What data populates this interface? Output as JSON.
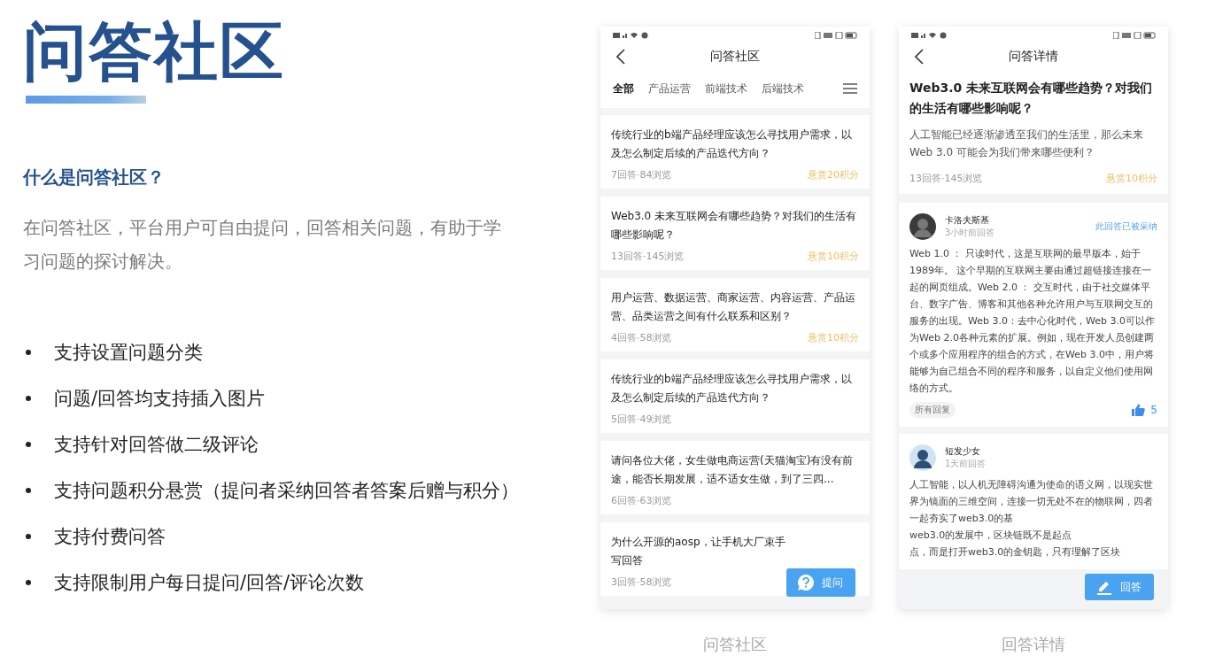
{
  "slide": {
    "title": "问答社区",
    "subtitle": "什么是问答社区？",
    "description": "在问答社区，平台用户可自由提问，回答相关问题，有助于学习问题的探讨解决。",
    "features": [
      "支持设置问题分类",
      "问题/回答均支持插入图片",
      "支持针对回答做二级评论",
      "支持问题积分悬赏（提问者采纳回答者答案后赠与积分）",
      "支持付费问答",
      "支持限制用户每日提问/回答/评论次数"
    ]
  },
  "list_screen": {
    "title": "问答社区",
    "caption": "问答社区",
    "tabs": [
      {
        "label": "全部",
        "selected": true
      },
      {
        "label": "产品运营",
        "selected": false
      },
      {
        "label": "前端技术",
        "selected": false
      },
      {
        "label": "后端技术",
        "selected": false
      }
    ],
    "questions": [
      {
        "lines": [
          "传统行业的b端产品经理应该怎么寻找用户需求，以及怎么制定后续的产品迭代方向？"
        ],
        "meta": "7回答·84浏览",
        "reward": "悬赏20积分"
      },
      {
        "lines": [
          "Web3.0 未来互联网会有哪些趋势？对我们的生活有哪些影响呢？"
        ],
        "meta": "13回答·145浏览",
        "reward": "悬赏10积分"
      },
      {
        "lines": [
          "用户运营、数据运营、商家运营、内容运营、产品运营、品类运营之间有什么联系和区别？"
        ],
        "meta": "4回答·58浏览",
        "reward": "悬赏10积分"
      },
      {
        "lines": [
          "传统行业的b端产品经理应该怎么寻找用户需求，以及怎么制定后续的产品迭代方向？"
        ],
        "meta": "5回答·49浏览"
      },
      {
        "lines": [
          "请问各位大佬，女生做电商运营(天猫淘宝)有没有前途，能否长期发展，适不适女生做，到了三四..."
        ],
        "meta": "6回答·63浏览"
      },
      {
        "lines": [
          "为什么开源的aosp，让手机大厂束手",
          "写回答"
        ],
        "meta": "3回答·58浏览"
      }
    ],
    "fab": "提问"
  },
  "detail_screen": {
    "title": "问答详情",
    "caption": "回答详情",
    "question": {
      "title": "Web3.0 未来互联网会有哪些趋势？对我们的生活有哪些影响呢？",
      "body": "人工智能已经逐渐渗透至我们的生活里，那么未来 Web 3.0 可能会为我们带来哪些便利？",
      "meta": "13回答·145浏览",
      "reward": "悬赏10积分"
    },
    "answers": [
      {
        "author": "卡洛夫斯基",
        "time": "3小时前回答",
        "accepted_label": "此回答已被采纳",
        "lines": [
          "Web 1.0 ： 只读时代，这是互联网的最早版本，始于1989年。 这个早期的互联网主要由通过超链接连接在一起的网页组成。Web 2.0 ： 交互时代，由于社交媒体平台、数字广告、博客和其他各种允许用户与互联网交互的服务的出现。Web 3.0：去中心化时代，Web 3.0可以作为Web 2.0各种元素的扩展。例如，现在开发人员创建两个或多个应用程序的组合的方式，在Web 3.0中，用户将能够为自己组合不同的程序和服务，以自定义他们使用网络的方式。"
        ],
        "replies": "所有回复",
        "likes": "5"
      },
      {
        "author": "短发少女",
        "time": "1天前回答",
        "lines": [
          "人工智能，以人机无障碍沟通为使命的语义网，以现实世界为镜面的三维空间，连接一切无处不在的物联网，四者一起夯实了web3.0的基",
          "web3.0的发展中，区块链既不是起点",
          "点，而是打开web3.0的金钥匙，只有理解了区块"
        ]
      }
    ],
    "fab": "回答"
  }
}
